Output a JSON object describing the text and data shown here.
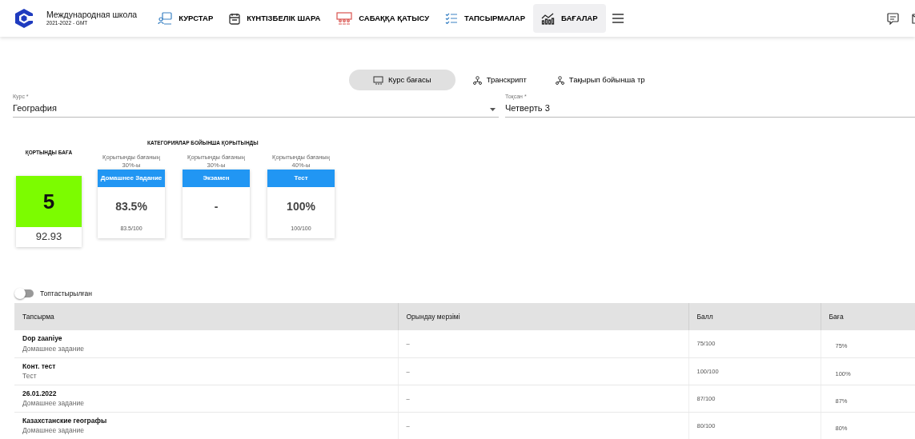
{
  "school": {
    "name": "Международная школа",
    "period": "2021-2022 - GMT"
  },
  "nav": [
    {
      "kind": "courses",
      "label": "КУРСТАР",
      "selected": false
    },
    {
      "kind": "calendar",
      "label": "КҮНТІЗБЕЛІК ШАРА",
      "selected": false
    },
    {
      "kind": "attendance",
      "label": "САБАҚҚА ҚАТЫСУ",
      "selected": false
    },
    {
      "kind": "tasks",
      "label": "ТАПСЫРМАЛАР",
      "selected": false
    },
    {
      "kind": "grades",
      "label": "БАҒАЛАР",
      "selected": true
    }
  ],
  "tabs": [
    {
      "label": "Курс бағасы",
      "selected": true
    },
    {
      "label": "Транскрипт",
      "selected": false
    },
    {
      "label": "Тақырып бойынша тр",
      "selected": false
    }
  ],
  "fields": [
    {
      "label": "Курс *",
      "value": "География"
    },
    {
      "label": "Тоқсан *",
      "value": "Четверть 3"
    }
  ],
  "final": {
    "title": "ҚОРТЫНДЫ БАҒА",
    "grade": "5",
    "score": "92.93"
  },
  "categories_title": "КАТЕГОРИЯЛАР БОЙЫНША ҚОРЫТЫНДЫ",
  "categories": [
    {
      "weight": "Қорытынды бағаның 30%-ы",
      "name": "Домашнее Задание",
      "percent": "83.5%",
      "score": "83.5/100"
    },
    {
      "weight": "Қорытынды бағаның 30%-ы",
      "name": "Экзамен",
      "percent": "-"
    },
    {
      "weight": "Қорытынды бағаның 40%-ы",
      "name": "Тест",
      "percent": "100%",
      "score": "100/100"
    }
  ],
  "grouped_toggle": {
    "label": "Топтастырылған",
    "on": false
  },
  "table": {
    "columns": [
      "Тапсырма",
      "Орындау мерзімі",
      "Балл",
      "Баға"
    ],
    "rows": [
      {
        "task": "Dop zaaniye",
        "type": "Домашнее задание",
        "due": "–",
        "points": "75/100",
        "grade": "75%"
      },
      {
        "task": "Конт. тест",
        "type": "Тест",
        "due": "–",
        "points": "100/100",
        "grade": "100%"
      },
      {
        "task": "26.01.2022",
        "type": "Домашнее задание",
        "due": "–",
        "points": "87/100",
        "grade": "87%"
      },
      {
        "task": "Казахстанские географы",
        "type": "Домашнее задание",
        "due": "–",
        "points": "80/100",
        "grade": "80%"
      }
    ]
  }
}
